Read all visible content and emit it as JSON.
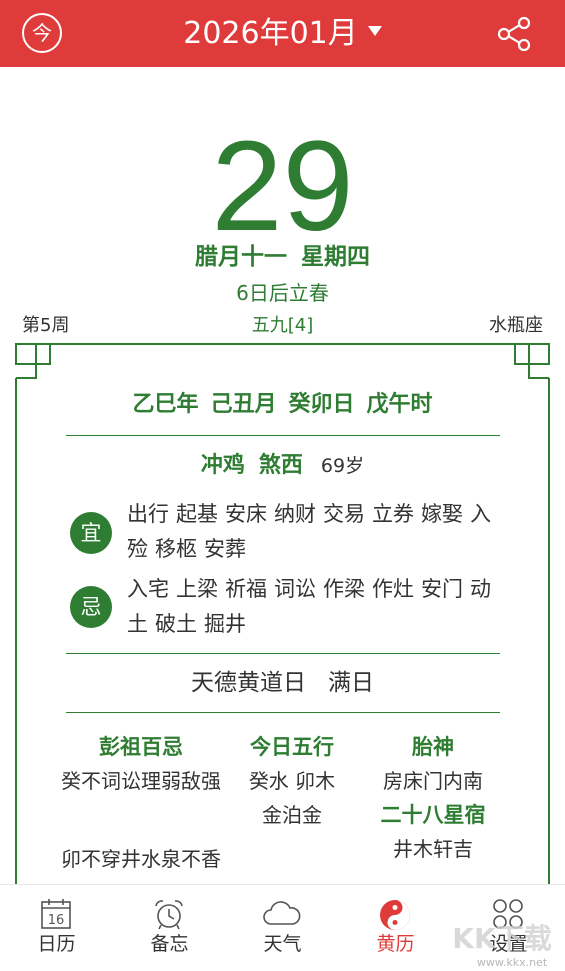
{
  "header": {
    "today_label": "今",
    "month_title": "2026年01月",
    "share_icon": "share-icon",
    "color": "#e03b3b"
  },
  "date": {
    "day": "29",
    "lunar": "腊月十一",
    "weekday": "星期四",
    "solar_term": "6日后立春",
    "week_no": "第5周",
    "shujiu": "五九[4]",
    "zodiac": "水瓶座"
  },
  "ganzhi": {
    "year": "乙巳年",
    "month": "己丑月",
    "day": "癸卯日",
    "hour": "戊午时"
  },
  "chong": {
    "chong": "冲鸡",
    "sha": "煞西",
    "age": "69岁"
  },
  "yi": {
    "badge": "宜",
    "items": [
      "出行",
      "起基",
      "安床",
      "纳财",
      "交易",
      "立券",
      "嫁娶",
      "入殓",
      "移柩",
      "安葬"
    ]
  },
  "ji": {
    "badge": "忌",
    "items": [
      "入宅",
      "上梁",
      "祈福",
      "词讼",
      "作梁",
      "作灶",
      "安门",
      "动土",
      "破土",
      "掘井"
    ]
  },
  "day_type": {
    "huangdao": "天德黄道日",
    "jianchu": "满日"
  },
  "details": {
    "pengzu_title": "彭祖百忌",
    "pengzu_1": "癸不词讼理弱敌强",
    "pengzu_2": "卯不穿井水泉不香",
    "wuxing_title": "今日五行",
    "wuxing_1": "癸水 卯木",
    "wuxing_2": "金泊金",
    "taishen_title": "胎神",
    "taishen": "房床门内南",
    "xingxiu_title": "二十八星宿",
    "xingxiu": "井木轩吉"
  },
  "nav": {
    "items": [
      {
        "label": "日历",
        "icon": "calendar-icon",
        "icon_text": "16"
      },
      {
        "label": "备忘",
        "icon": "alarm-clock-icon"
      },
      {
        "label": "天气",
        "icon": "cloud-icon"
      },
      {
        "label": "黄历",
        "icon": "yin-yang-icon",
        "active": true
      },
      {
        "label": "设置",
        "icon": "settings-grid-icon"
      }
    ]
  },
  "watermark": {
    "text": "KK下载",
    "url_text": "www.kkx.net"
  },
  "colors": {
    "accent_green": "#2e7d32",
    "accent_red": "#e03b3b"
  }
}
